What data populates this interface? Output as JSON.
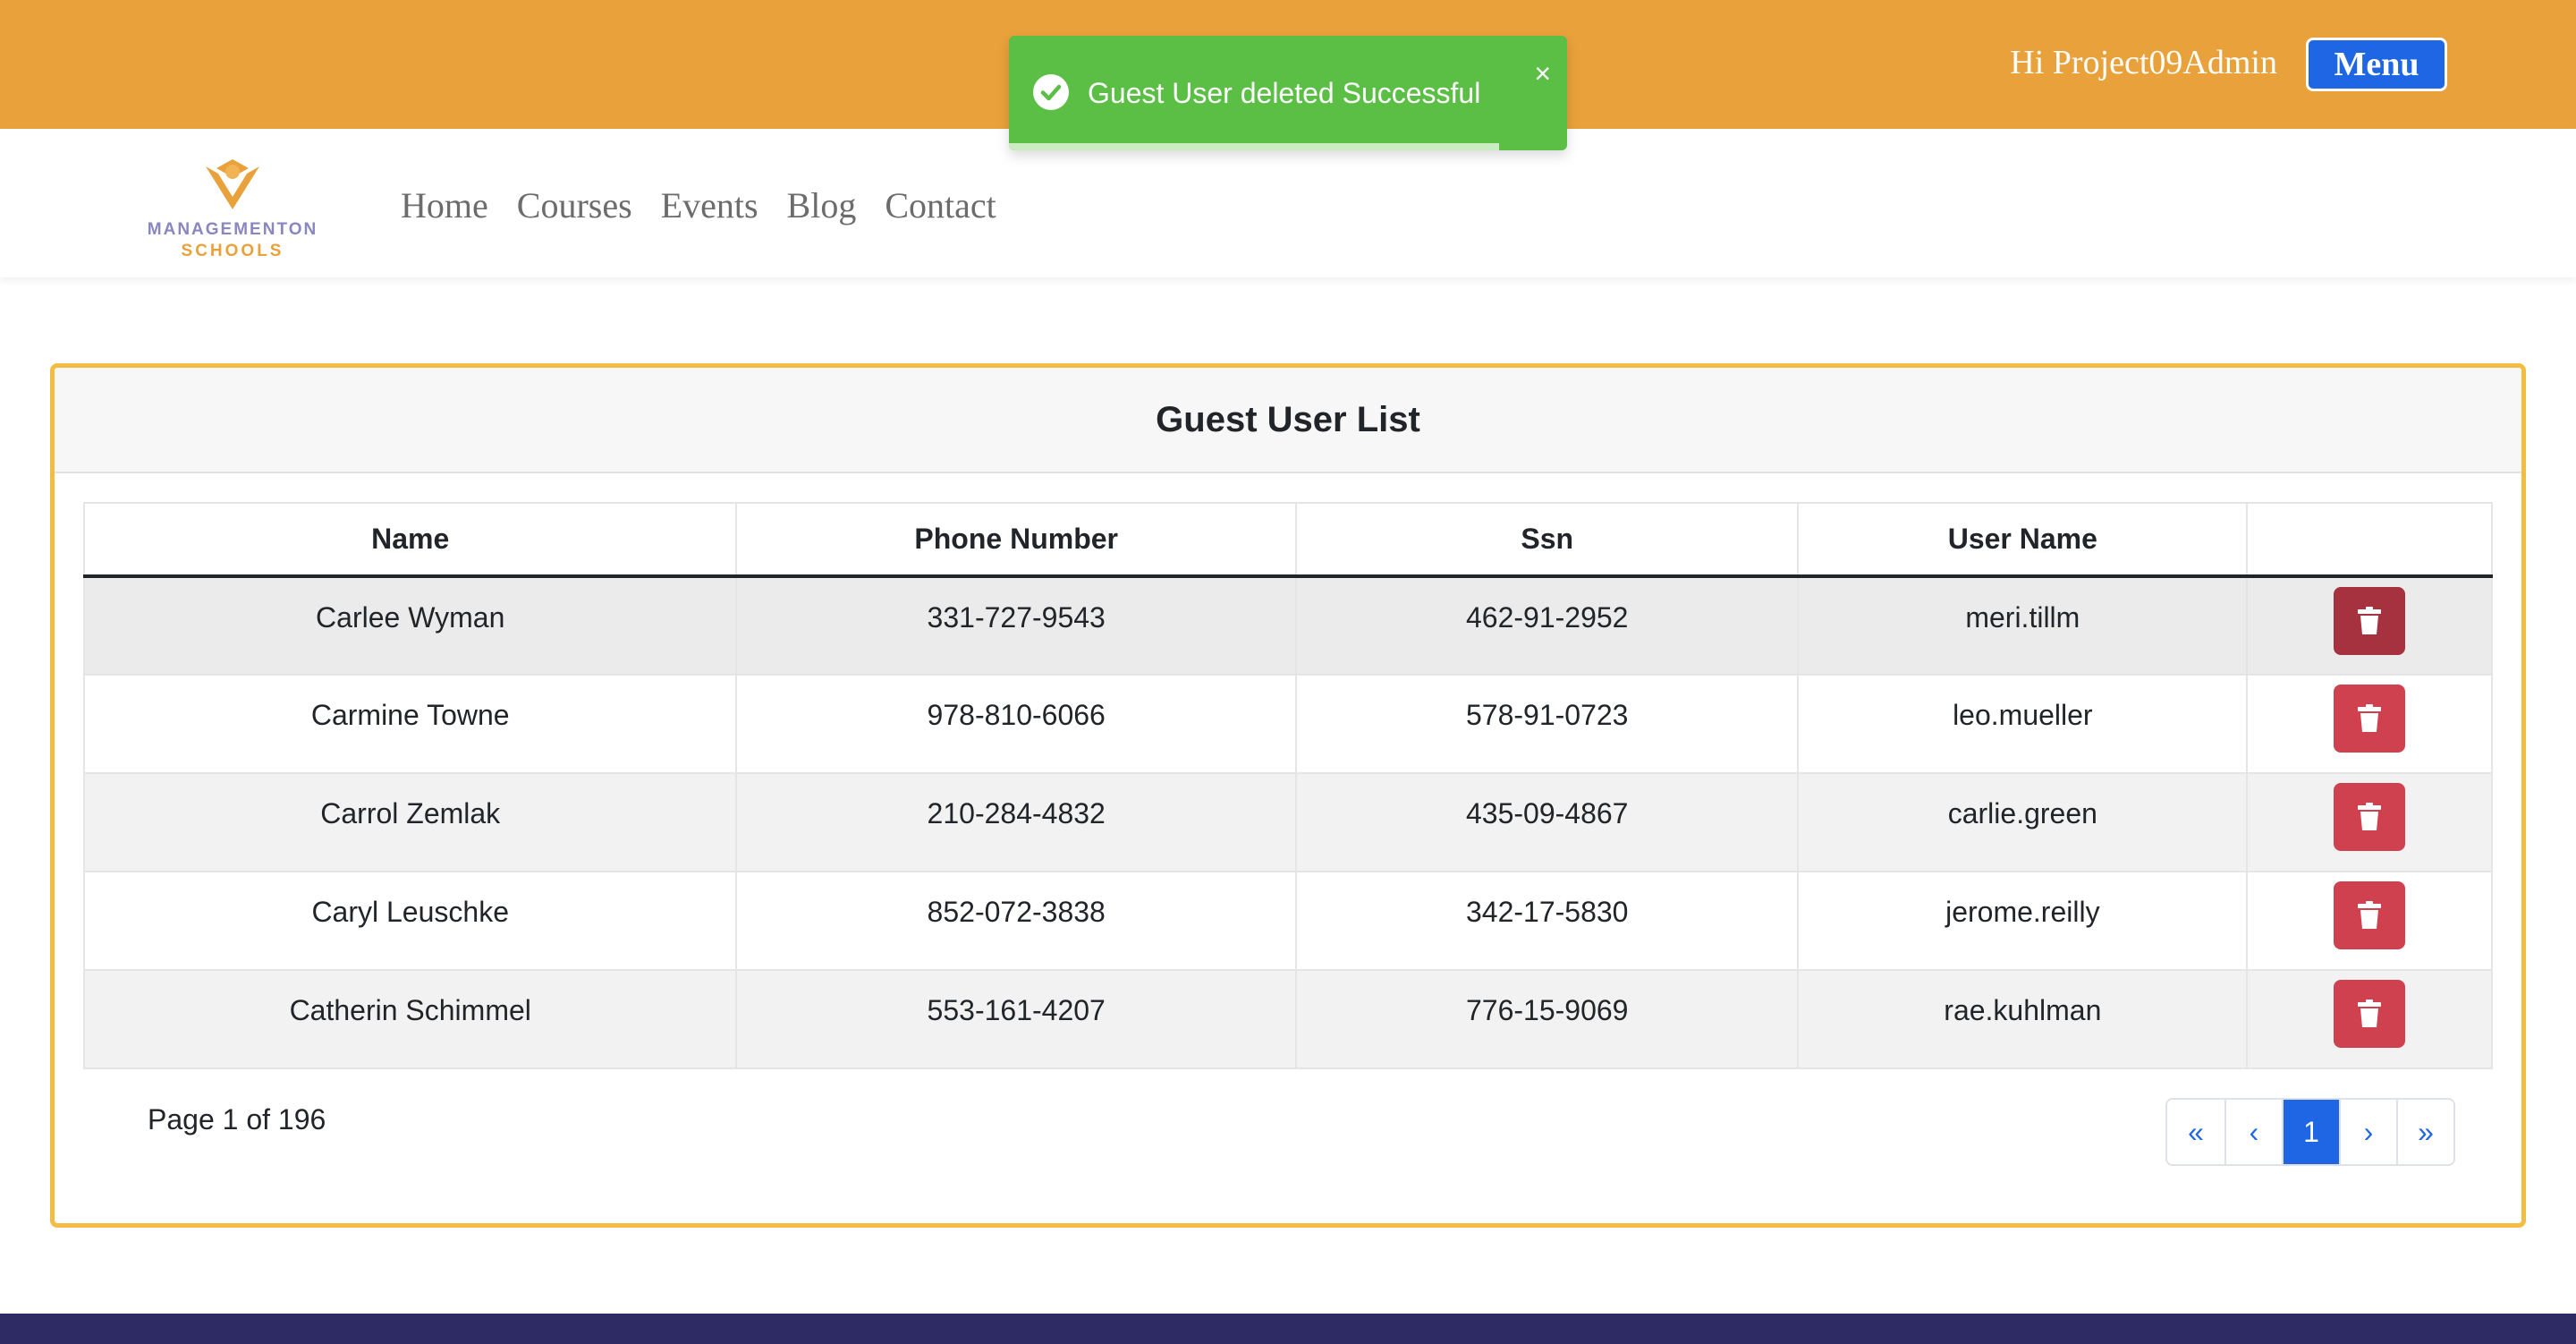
{
  "topbar": {
    "greeting": "Hi Project09Admin",
    "menu_label": "Menu",
    "background": "#e9a23b"
  },
  "toast": {
    "message": "Guest User deleted Successful",
    "close": "×",
    "icon": "check-circle-icon",
    "color": "#5bbf45"
  },
  "brand": {
    "line1": "MANAGEMENTON",
    "line2": "SCHOOLS"
  },
  "nav": [
    "Home",
    "Courses",
    "Events",
    "Blog",
    "Contact"
  ],
  "card": {
    "title": "Guest User List",
    "columns": [
      "Name",
      "Phone Number",
      "Ssn",
      "User Name",
      ""
    ],
    "rows": [
      {
        "name": "Carlee Wyman",
        "phone": "331-727-9543",
        "ssn": "462-91-2952",
        "username": "meri.tillm"
      },
      {
        "name": "Carmine Towne",
        "phone": "978-810-6066",
        "ssn": "578-91-0723",
        "username": "leo.mueller"
      },
      {
        "name": "Carrol Zemlak",
        "phone": "210-284-4832",
        "ssn": "435-09-4867",
        "username": "carlie.green"
      },
      {
        "name": "Caryl Leuschke",
        "phone": "852-072-3838",
        "ssn": "342-17-5830",
        "username": "jerome.reilly"
      },
      {
        "name": "Catherin Schimmel",
        "phone": "553-161-4207",
        "ssn": "776-15-9069",
        "username": "rae.kuhlman"
      }
    ],
    "delete_icon": "trash-icon",
    "page_text": "Page 1 of 196",
    "pagination": {
      "first": "«",
      "prev": "‹",
      "current": "1",
      "next": "›",
      "last": "»"
    }
  },
  "colors": {
    "accent": "#1f66e5",
    "danger": "#d0414f",
    "card_border": "#f3bd43",
    "footer": "#2e2a64"
  }
}
